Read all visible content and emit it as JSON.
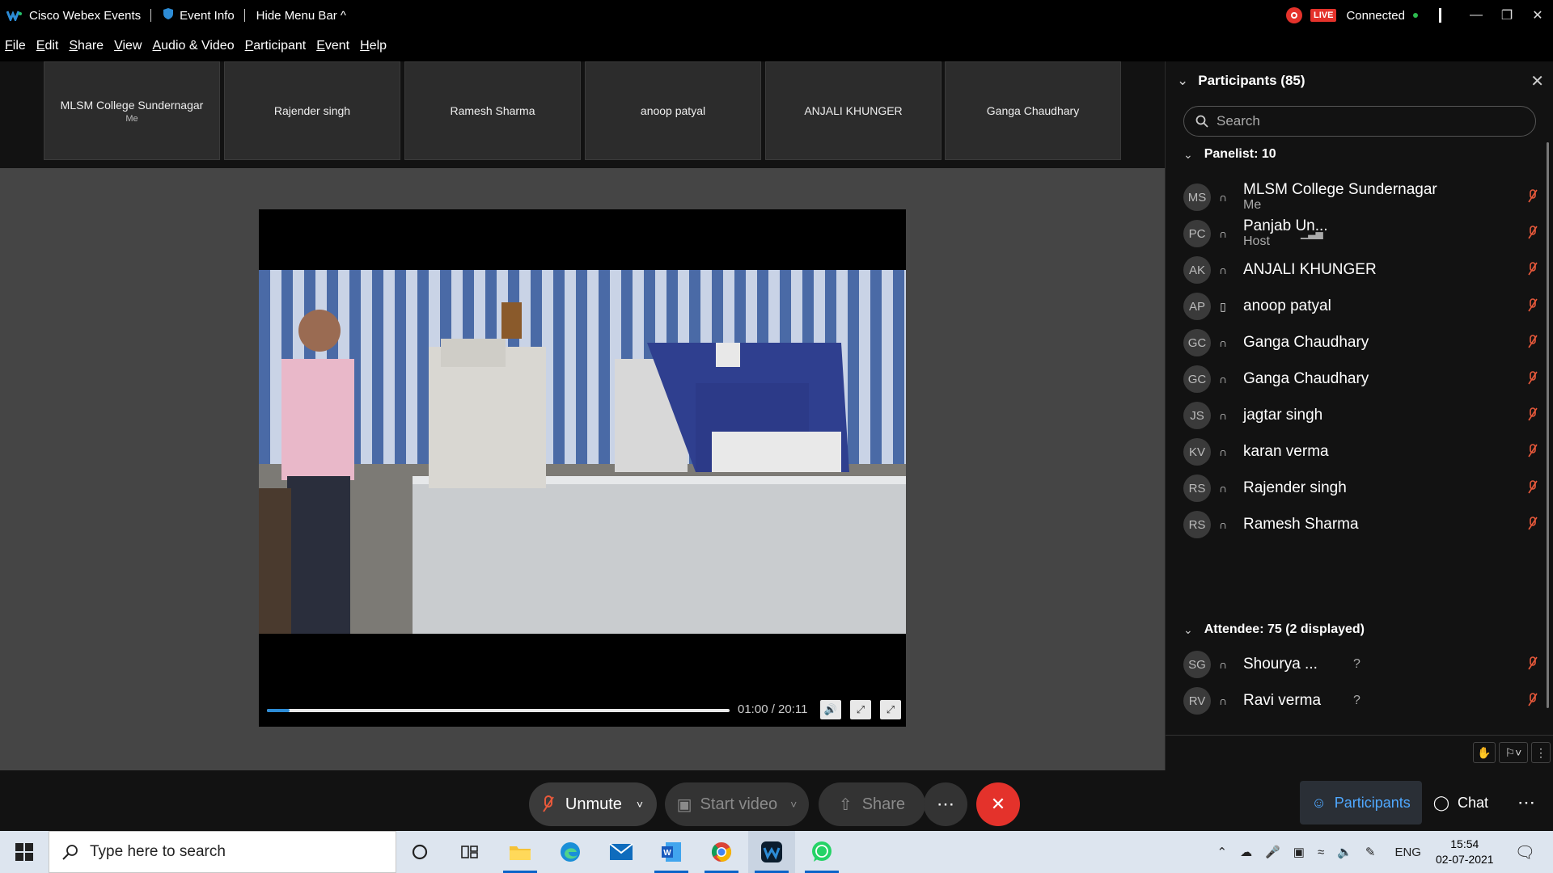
{
  "titlebar": {
    "app_name": "Cisco Webex Events",
    "event_info": "Event Info",
    "hide_menu": "Hide Menu Bar ^",
    "live": "LIVE",
    "status": "Connected"
  },
  "menu": [
    "File",
    "Edit",
    "Share",
    "View",
    "Audio & Video",
    "Participant",
    "Event",
    "Help"
  ],
  "filmstrip": [
    {
      "name": "MLSM College Sundernagar",
      "sub": "Me"
    },
    {
      "name": "Rajender singh",
      "sub": ""
    },
    {
      "name": "Ramesh Sharma",
      "sub": ""
    },
    {
      "name": "anoop patyal",
      "sub": ""
    },
    {
      "name": "ANJALI KHUNGER",
      "sub": ""
    },
    {
      "name": "Ganga Chaudhary",
      "sub": ""
    }
  ],
  "player": {
    "time": "01:00 / 20:11",
    "progress_fraction": 0.0497
  },
  "panel": {
    "title": "Participants (85)",
    "search_placeholder": "Search",
    "panelist_header": "Panelist: 10",
    "attendee_header": "Attendee: 75 (2 displayed)",
    "panelists": [
      {
        "initials": "MS",
        "name": "MLSM College Sundernagar",
        "role": "Me",
        "audio": "headset"
      },
      {
        "initials": "PC",
        "name": "Panjab Un...",
        "role": "Host",
        "audio": "headset"
      },
      {
        "initials": "AK",
        "name": "ANJALI KHUNGER",
        "role": "",
        "audio": "headset"
      },
      {
        "initials": "AP",
        "name": "anoop patyal",
        "role": "",
        "audio": "phone"
      },
      {
        "initials": "GC",
        "name": "Ganga Chaudhary",
        "role": "",
        "audio": "headset"
      },
      {
        "initials": "GC",
        "name": "Ganga Chaudhary",
        "role": "",
        "audio": "headset"
      },
      {
        "initials": "JS",
        "name": "jagtar singh",
        "role": "",
        "audio": "headset"
      },
      {
        "initials": "KV",
        "name": "karan verma",
        "role": "",
        "audio": "headset"
      },
      {
        "initials": "RS",
        "name": "Rajender singh",
        "role": "",
        "audio": "headset"
      },
      {
        "initials": "RS",
        "name": "Ramesh Sharma",
        "role": "",
        "audio": "headset"
      }
    ],
    "attendees": [
      {
        "initials": "SG",
        "name": "Shourya ...",
        "mark": "?"
      },
      {
        "initials": "RV",
        "name": "Ravi verma",
        "mark": "?"
      }
    ]
  },
  "toolbar": {
    "unmute": "Unmute",
    "start_video": "Start video",
    "share": "Share",
    "participants_tab": "Participants",
    "chat_tab": "Chat"
  },
  "taskbar": {
    "search_placeholder": "Type here to search",
    "lang": "ENG",
    "time": "15:54",
    "date": "02-07-2021"
  },
  "colors": {
    "accent": "#2d8cd6",
    "mute_red": "#e8593b",
    "end_red": "#e4322b",
    "live_red": "#e4322b"
  }
}
